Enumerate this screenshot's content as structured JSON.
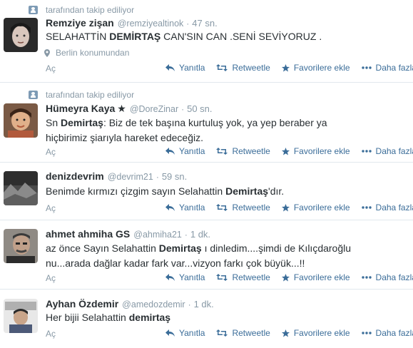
{
  "tweets": [
    {
      "context": "tarafından takip ediliyor",
      "fullname": "Remziye zişan",
      "verified_star": "",
      "handle": "@remziyealtinok",
      "time": "47 sn.",
      "text_html": "SELAHATTİN <b>DEMİRTAŞ</b> CAN'SIN CAN .SENİ SEVİYORUZ .",
      "location": "Berlin konumundan",
      "expand": "Aç",
      "avatar_colors": [
        "#2a2a2a",
        "#d9c7bd"
      ]
    },
    {
      "context": "tarafından takip ediliyor",
      "fullname": "Hümeyra Kaya",
      "verified_star": "★",
      "handle": "@DoreZinar",
      "time": "50 sn.",
      "text_html": "Sn <b>Demirtaş</b>: Biz de tek başına kurtuluş yok, ya yep beraber ya hiçbirimiz şiarıyla hareket edeceğiz.",
      "location": "",
      "expand": "Aç",
      "avatar_colors": [
        "#c9a27a",
        "#b25a3c"
      ]
    },
    {
      "context": "",
      "fullname": "denizdevrim",
      "verified_star": "",
      "handle": "@devrim21",
      "time": "59 sn.",
      "text_html": "Benimde kırmızı çizgim sayın Selahattin <b>Demirtaş</b>'dır.",
      "location": "",
      "expand": "Aç",
      "avatar_colors": [
        "#3c3c3c",
        "#9b9b9b"
      ]
    },
    {
      "context": "",
      "fullname": "ahmet ahmiha GS",
      "verified_star": "",
      "handle": "@ahmiha21",
      "time": "1 dk.",
      "text_html": "az önce Sayın Selahattin <b>Demirtaş</b> ı dinledim....şimdi de Kılıçdaroğlu nu...arada dağlar kadar fark var...vizyon farkı çok büyük...!!",
      "location": "",
      "expand": "Aç",
      "avatar_colors": [
        "#6b6b6b",
        "#c0b8b0"
      ]
    },
    {
      "context": "",
      "fullname": "Ayhan Özdemir",
      "verified_star": "",
      "handle": "@amedozdemir",
      "time": "1 dk.",
      "text_html": "Her bijii Selahattin <b>demirtaş</b>",
      "location": "",
      "expand": "Aç",
      "avatar_colors": [
        "#e8e8e8",
        "#4d5a78"
      ]
    }
  ],
  "actions": {
    "reply": "Yanıtla",
    "retweet": "Retweetle",
    "favorite": "Favorilere ekle",
    "more": "Daha fazla"
  },
  "colors": {
    "action_blue": "#3b6d99",
    "meta_gray": "#8899a6",
    "text_dark": "#292f33",
    "context_icon": "#7e9bb5"
  },
  "icons": {
    "context": "person-icon",
    "location": "location-pin-icon",
    "reply": "reply-arrow-icon",
    "retweet": "retweet-icon",
    "favorite": "star-icon",
    "more": "ellipsis-icon"
  }
}
